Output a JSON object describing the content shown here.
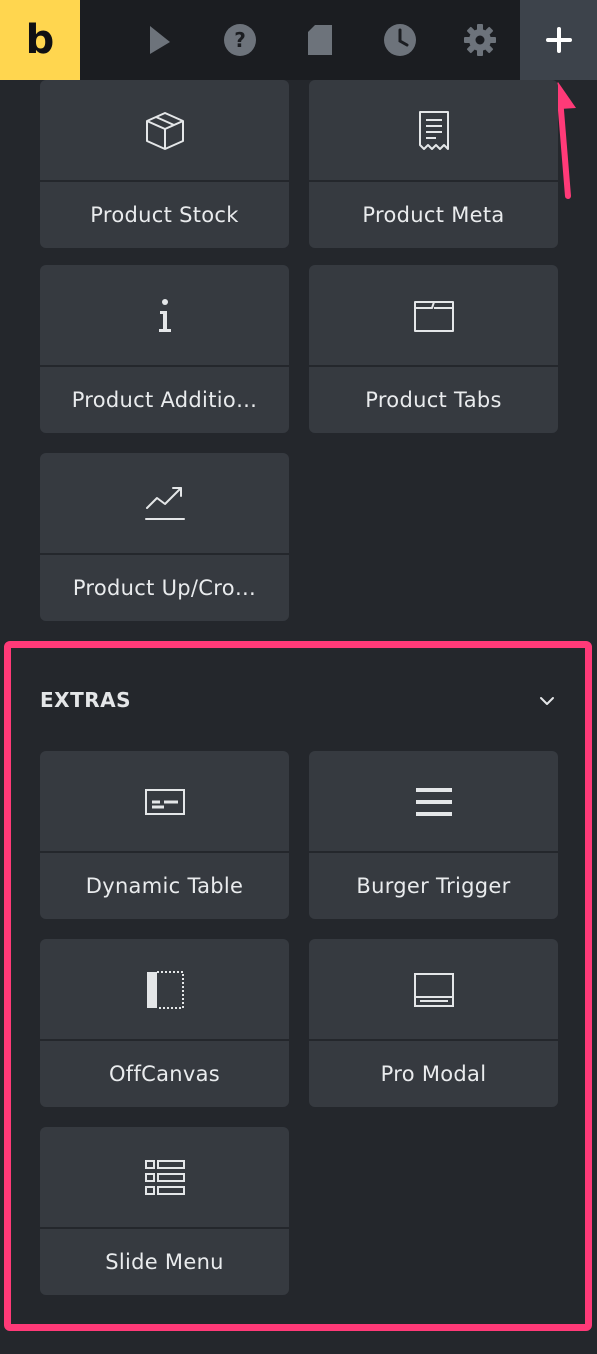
{
  "toolbar": {
    "logo_text": "b",
    "icons": [
      "cursor-icon",
      "help-icon",
      "page-icon",
      "history-icon",
      "settings-icon"
    ],
    "add_icon": "plus-icon"
  },
  "elements_above": [
    {
      "label": "Product Stock",
      "icon": "box-icon"
    },
    {
      "label": "Product Meta",
      "icon": "receipt-icon"
    },
    {
      "label": "Product Additio…",
      "icon": "info-icon"
    },
    {
      "label": "Product Tabs",
      "icon": "folder-icon"
    },
    {
      "label": "Product Up/Cro…",
      "icon": "trend-icon"
    }
  ],
  "extras": {
    "title": "EXTRAS",
    "items": [
      {
        "label": "Dynamic Table",
        "icon": "table-icon"
      },
      {
        "label": "Burger Trigger",
        "icon": "burger-icon"
      },
      {
        "label": "OffCanvas",
        "icon": "offcanvas-icon"
      },
      {
        "label": "Pro Modal",
        "icon": "modal-icon"
      },
      {
        "label": "Slide Menu",
        "icon": "list-icon"
      }
    ]
  },
  "colors": {
    "accent": "#ffd64f",
    "highlight": "#ff3a78",
    "panel": "#24272c",
    "tile": "#363a40"
  }
}
